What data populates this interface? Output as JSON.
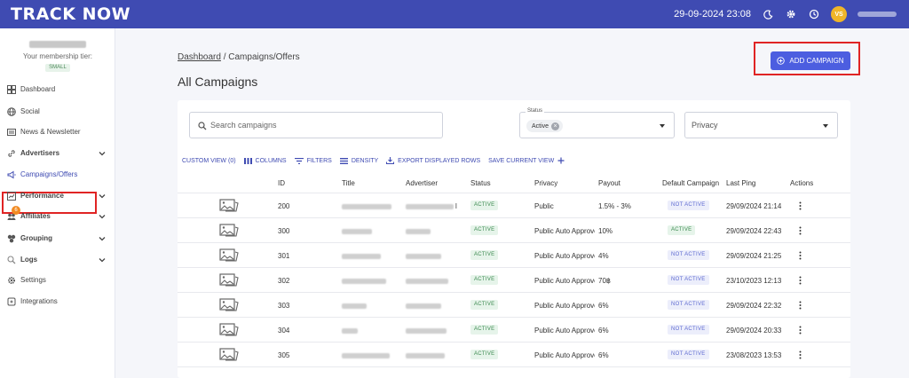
{
  "header": {
    "logo": "TRACK NOW",
    "datetime": "29-09-2024 23:08",
    "avatar_initials": "VS",
    "brand_color": "#3f4bb2"
  },
  "sidebar": {
    "tier_text": "Your membership tier:",
    "tier_badge": "SMALL",
    "items": [
      {
        "label": "Dashboard",
        "icon": "dashboard-icon"
      },
      {
        "label": "Social",
        "icon": "globe-icon"
      },
      {
        "label": "News & Newsletter",
        "icon": "newspaper-icon"
      },
      {
        "label": "Advertisers",
        "icon": "link-icon",
        "expandable": true
      },
      {
        "label": "Campaigns/Offers",
        "icon": "megaphone-icon",
        "active": true
      },
      {
        "label": "Performance",
        "icon": "chart-icon",
        "expandable": true
      },
      {
        "label": "Affiliates",
        "icon": "users-icon",
        "expandable": true,
        "badge": "6"
      },
      {
        "label": "Grouping",
        "icon": "group-icon",
        "expandable": true
      },
      {
        "label": "Logs",
        "icon": "search-icon",
        "expandable": true
      },
      {
        "label": "Settings",
        "icon": "gear-icon"
      },
      {
        "label": "Integrations",
        "icon": "plug-icon"
      }
    ]
  },
  "breadcrumb": {
    "root": "Dashboard",
    "separator": "/",
    "current": "Campaigns/Offers"
  },
  "page_title": "All Campaigns",
  "add_button": "ADD CAMPAIGN",
  "filters": {
    "search_placeholder": "Search campaigns",
    "status_label": "Status",
    "status_chip": "Active",
    "privacy_placeholder": "Privacy"
  },
  "toolbar": {
    "custom_view": "CUSTOM VIEW (0)",
    "columns": "COLUMNS",
    "filters": "FILTERS",
    "density": "DENSITY",
    "export": "EXPORT DISPLAYED ROWS",
    "save_view": "SAVE CURRENT VIEW"
  },
  "table": {
    "headers": {
      "id": "ID",
      "title": "Title",
      "advertiser": "Advertiser",
      "status": "Status",
      "privacy": "Privacy",
      "payout": "Payout",
      "default_campaign": "Default Campaign",
      "last_ping": "Last Ping",
      "actions": "Actions"
    },
    "rows": [
      {
        "id": "200",
        "status": "ACTIVE",
        "privacy": "Public",
        "payout": "1.5% - 3%",
        "default": "NOT ACTIVE",
        "last_ping": "29/09/2024 21:14",
        "advertiser_suffix": "l"
      },
      {
        "id": "300",
        "status": "ACTIVE",
        "privacy": "Public Auto Approve",
        "payout": "10%",
        "default": "ACTIVE",
        "last_ping": "29/09/2024 22:43"
      },
      {
        "id": "301",
        "status": "ACTIVE",
        "privacy": "Public Auto Approve",
        "payout": "4%",
        "default": "NOT ACTIVE",
        "last_ping": "29/09/2024 21:25"
      },
      {
        "id": "302",
        "status": "ACTIVE",
        "privacy": "Public Auto Approve",
        "payout": "70฿",
        "default": "NOT ACTIVE",
        "last_ping": "23/10/2023 12:13"
      },
      {
        "id": "303",
        "status": "ACTIVE",
        "privacy": "Public Auto Approve",
        "payout": "6%",
        "default": "NOT ACTIVE",
        "last_ping": "29/09/2024 22:32"
      },
      {
        "id": "304",
        "status": "ACTIVE",
        "privacy": "Public Auto Approve",
        "payout": "6%",
        "default": "NOT ACTIVE",
        "last_ping": "29/09/2024 20:33"
      },
      {
        "id": "305",
        "status": "ACTIVE",
        "privacy": "Public Auto Approve",
        "payout": "6%",
        "default": "NOT ACTIVE",
        "last_ping": "23/08/2023 13:53"
      }
    ]
  }
}
